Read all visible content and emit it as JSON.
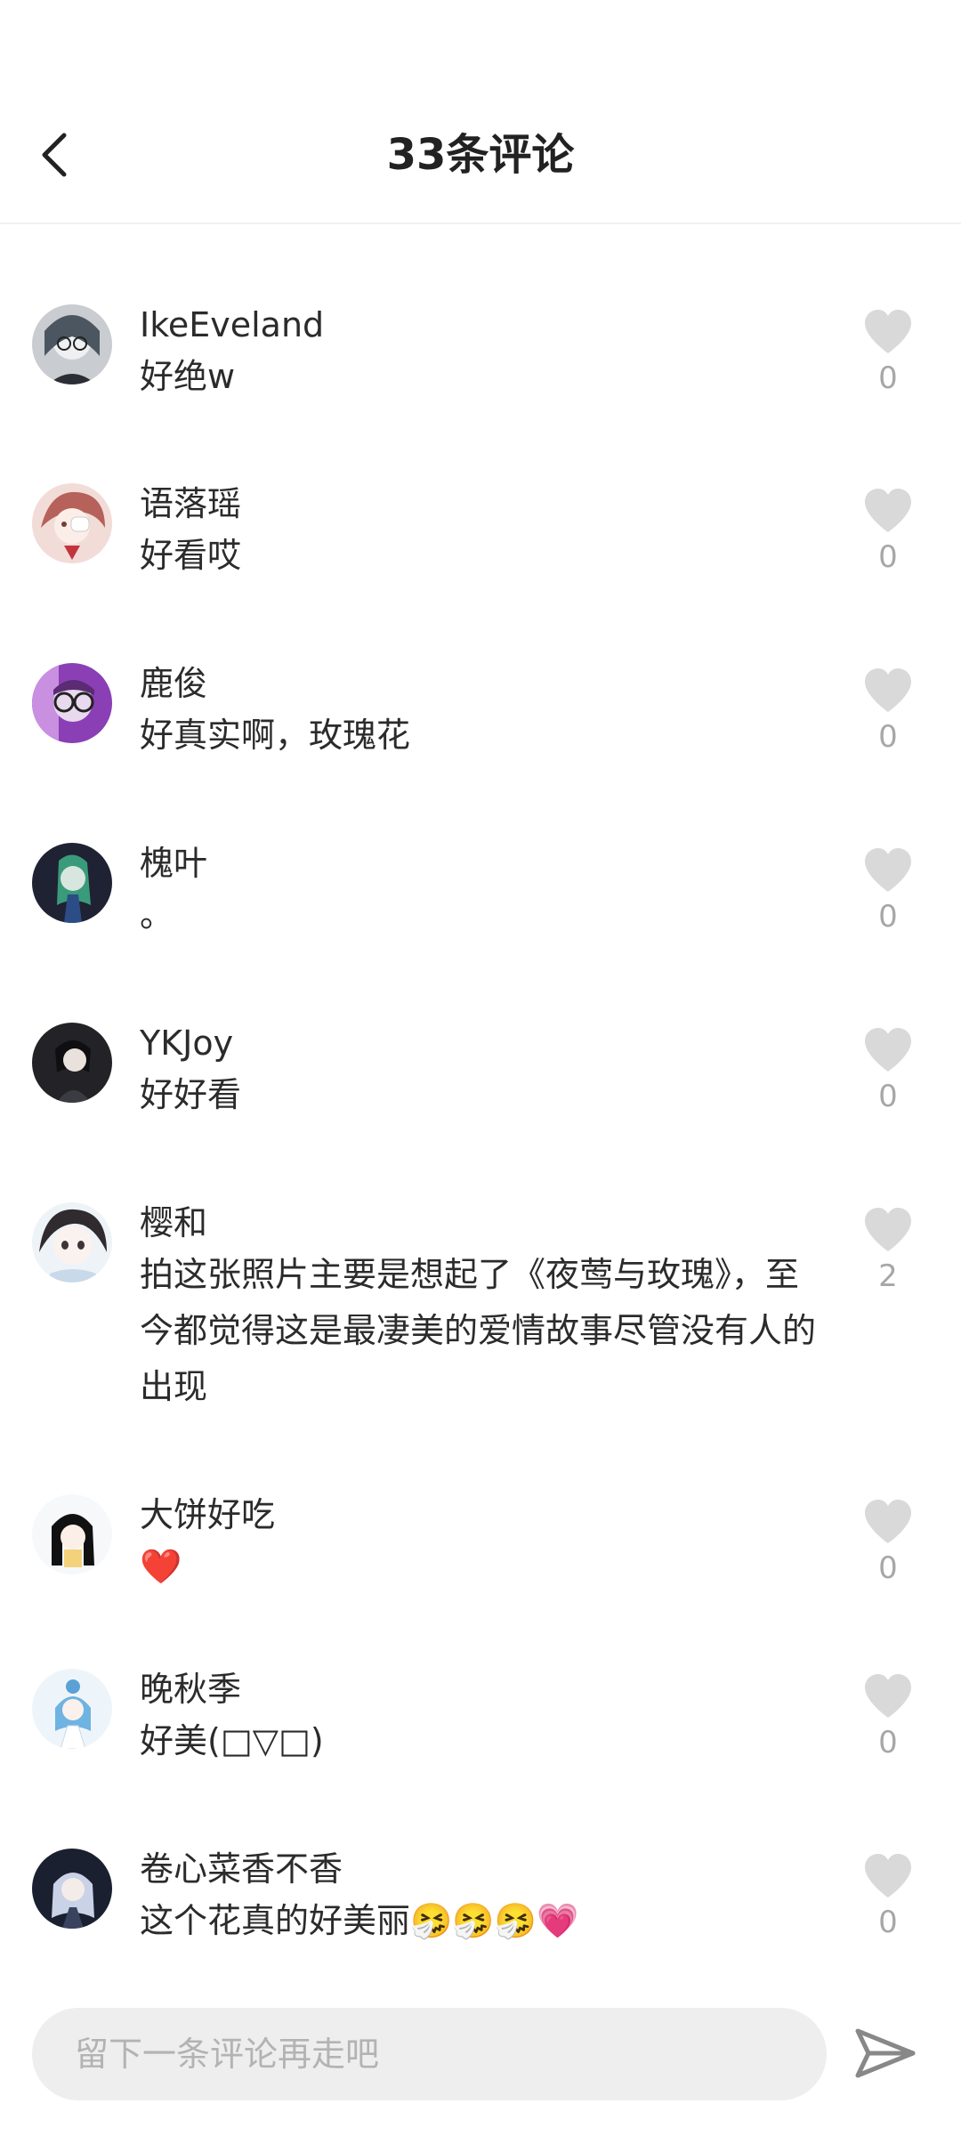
{
  "header": {
    "title": "33条评论"
  },
  "comments": [
    {
      "username": "IkeEveland",
      "text": "好绝w",
      "likes": "0"
    },
    {
      "username": "语落瑶",
      "text": "好看哎",
      "likes": "0"
    },
    {
      "username": "鹿俊",
      "text": "好真实啊，玫瑰花",
      "likes": "0"
    },
    {
      "username": "槐叶",
      "text": "。",
      "likes": "0"
    },
    {
      "username": "YKJoy",
      "text": "好好看",
      "likes": "0"
    },
    {
      "username": "樱和",
      "text": "拍这张照片主要是想起了《夜莺与玫瑰》，至今都觉得这是最凄美的爱情故事尽管没有人的出现",
      "likes": "2"
    },
    {
      "username": "大饼好吃",
      "text": "❤️",
      "likes": "0"
    },
    {
      "username": "晚秋季",
      "text": "好美(□▽□)",
      "likes": "0"
    },
    {
      "username": "卷心菜香不香",
      "text": "这个花真的好美丽🤧🤧🤧💗",
      "likes": "0"
    }
  ],
  "footer": {
    "input_placeholder": "留下一条评论再走吧"
  },
  "colors": {
    "heart": "#d9d9d9",
    "count": "#a7a7a7",
    "input_bg": "#eeeeee"
  },
  "icons": {
    "back": "chevron-left-icon",
    "like": "heart-icon",
    "send": "send-icon"
  }
}
